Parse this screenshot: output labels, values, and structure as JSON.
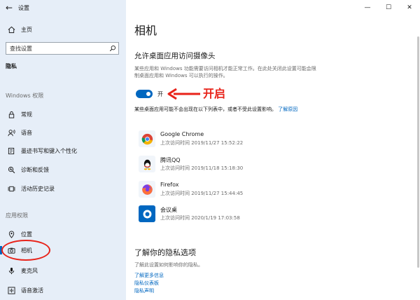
{
  "window": {
    "app_title": "设置",
    "back_glyph": "←",
    "minimize": "—",
    "maximize": "☐",
    "close": "✕"
  },
  "sidebar": {
    "home_label": "主页",
    "search_placeholder": "查找设置",
    "section_title": "隐私",
    "windows_group": "Windows 权限",
    "windows_items": [
      {
        "label": "常规",
        "icon": "lock-icon"
      },
      {
        "label": "语音",
        "icon": "speech-icon"
      },
      {
        "label": "墨迹书写和键入个性化",
        "icon": "pen-icon"
      },
      {
        "label": "诊断和反馈",
        "icon": "diagnostics-icon"
      },
      {
        "label": "活动历史记录",
        "icon": "timeline-icon"
      }
    ],
    "app_group": "应用权限",
    "app_items": [
      {
        "label": "位置",
        "icon": "location-icon"
      },
      {
        "label": "相机",
        "icon": "camera-icon",
        "selected": true
      },
      {
        "label": "麦克风",
        "icon": "microphone-icon"
      },
      {
        "label": "语音激活",
        "icon": "voice-activation-icon"
      }
    ]
  },
  "main": {
    "page_title": "相机",
    "section_title": "允许桌面应用访问摄像头",
    "description": "某些应用和 Windows 功能需要访问相机才能正常工作。在此处关闭此设置可能会限制桌面应用和 Windows 可以执行的操作。",
    "toggle_state": "开",
    "toggle_on": true,
    "annotation": "开启",
    "note_text": "某些桌面应用可能不会出现在以下列表中，或者不受此设置影响。",
    "note_link": "了解原因",
    "apps": [
      {
        "name": "Google Chrome",
        "last_access": "上次访问时间 2019/11/27 15:52:22",
        "icon": "chrome-icon"
      },
      {
        "name": "腾讯QQ",
        "last_access": "上次访问时间 2019/11/18 15:18:30",
        "icon": "qq-icon"
      },
      {
        "name": "Firefox",
        "last_access": "上次访问时间 2019/11/27 15:44:45",
        "icon": "firefox-icon"
      },
      {
        "name": "会议桌",
        "last_access": "上次访问时间 2020/1/19 17:03:58",
        "icon": "meeting-icon"
      }
    ],
    "privacy_title": "了解你的隐私选项",
    "privacy_desc": "了解此设置如何影响你的隐私。",
    "privacy_links": [
      "了解更多信息",
      "隐私仪表板",
      "隐私声明"
    ]
  },
  "colors": {
    "accent": "#0067c0",
    "annotation_red": "#e8231a",
    "sidebar_bg": "#e6eef8"
  }
}
